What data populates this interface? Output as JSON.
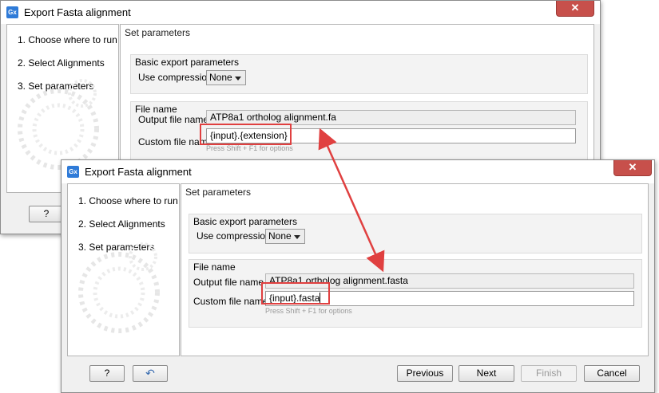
{
  "back_dialog": {
    "title": "Export Fasta alignment",
    "steps": [
      {
        "label": "1.  Choose where to run"
      },
      {
        "label": "2.  Select Alignments"
      },
      {
        "label": "3.  Set parameters"
      }
    ],
    "panel_title": "Set parameters",
    "basic_group": {
      "label": "Basic export parameters",
      "compression_label": "Use compression",
      "compression_value": "None"
    },
    "file_group": {
      "label": "File name",
      "output_label": "Output file name",
      "output_value": "ATP8a1 ortholog alignment.fa",
      "custom_label": "Custom file name",
      "custom_value": "{input}.{extension}",
      "hint": "Press Shift + F1 for options"
    },
    "help_button": "?"
  },
  "front_dialog": {
    "title": "Export Fasta alignment",
    "steps": [
      {
        "label": "1.  Choose where to run"
      },
      {
        "label": "2.  Select Alignments"
      },
      {
        "label": "3.  Set parameters"
      }
    ],
    "panel_title": "Set parameters",
    "basic_group": {
      "label": "Basic export parameters",
      "compression_label": "Use compression",
      "compression_value": "None"
    },
    "file_group": {
      "label": "File name",
      "output_label": "Output file name",
      "output_value": "ATP8a1 ortholog alignment.fasta",
      "custom_label": "Custom file name",
      "custom_value": "{input}.fasta",
      "hint": "Press Shift + F1 for options"
    },
    "buttons": {
      "help": "?",
      "reset": "↶",
      "previous": "Previous",
      "next": "Next",
      "finish": "Finish",
      "cancel": "Cancel"
    }
  },
  "colors": {
    "highlight": "#e04040",
    "arrow": "#e04040",
    "close": "#c7504b"
  },
  "icons": {
    "app": "gx-app-icon",
    "close": "close-icon",
    "dropdown": "chevron-down-icon",
    "reset": "undo-icon"
  }
}
